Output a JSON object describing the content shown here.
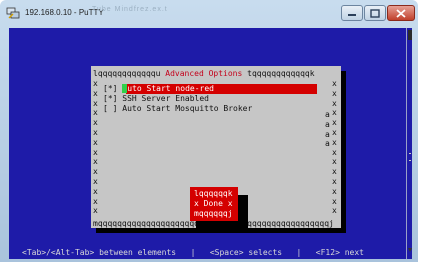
{
  "window": {
    "title": "192.168.0.10 - PuTTY",
    "faded_text": "Tube Mindfrez.ex.t",
    "controls": {
      "minimize": "—",
      "maximize": "☐",
      "close": "X"
    }
  },
  "dialog": {
    "title_left": "lqqqqqqqqqqqqu ",
    "title": "Advanced Options",
    "title_right": " tqqqqqqqqqqqqk",
    "border_left": "x\nx\nx\nx\nx\nx\nx\nx\nx\nx\nx\nx\nx\nx",
    "border_right": "x\nx\nx\nx\nx\nx\nx\nx\nx\nx\nx\nx\nx\nx",
    "a_marks": "a\na\na\na",
    "bottom_line": "mqqqqqqqqqqqqqqqqqqqqqqqqqqqqqqqqqqqqqqqqqqqqqqqqj",
    "options": [
      {
        "check": "[*] ",
        "label": "Auto Start node-red",
        "cursor_char": "A",
        "label_rest": "uto Start node-red"
      },
      {
        "check": "[*] ",
        "label": "SSH Server Enabled"
      },
      {
        "check": "[ ] ",
        "label": "Auto Start Mosquitto Broker"
      }
    ]
  },
  "done_box": {
    "top": "lqqqqqqk",
    "middle": "x Done x",
    "bottom": "mqqqqqqj"
  },
  "footer": {
    "text": "<Tab>/<Alt-Tab> between elements   |   <Space> selects   |   <F12> next"
  },
  "colors": {
    "terminal_bg": "#1e1ba8",
    "dialog_bg": "#c6c6c6",
    "highlight": "#d40000",
    "cursor": "#2fd14a",
    "title_text": "#c4001a"
  }
}
